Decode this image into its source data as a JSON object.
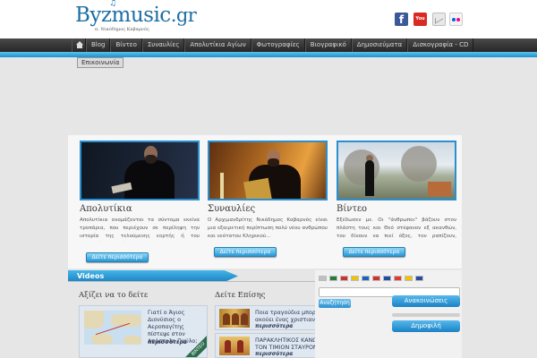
{
  "header": {
    "logo_text": "Byzmusic",
    "logo_tld": ".gr",
    "logo_note": "♫",
    "logo_subtitle": "π. Νικόδημος Καβαρνός",
    "social": [
      "facebook-icon",
      "youtube-icon",
      "mail-icon",
      "flickr-icon"
    ],
    "youtube_label": "You Tube",
    "facebook_label": "f"
  },
  "nav": {
    "items": [
      "Blog",
      "Βίντεο",
      "Συναυλίες",
      "Απολυτίκια Αγίων",
      "Φωτογραφίες",
      "Βιογραφικό",
      "Δημοσιεύματα",
      "Δισκογραφία - CD"
    ],
    "extra": "Επικοινωνία"
  },
  "features": [
    {
      "title": "Απολυτίκια",
      "text": "Απολυτίκια ονομάζονται τα σύντομα εκείνα τροπάρια, που περιέχουν σε περίληψη την ιστορία της τελούμενης εορτής ή του εορταζόμενου Αγίου.",
      "more": "Δείτε περισσότερα"
    },
    {
      "title": "Συναυλίες",
      "text": "Ο Αρχιμανδρίτης Νικόδημος Καβαρνός είναι μια εξαιρετική περίπτωση πολύ νέου ανθρώπου και νεότατου Κληρικού...",
      "more": "Δείτε περισσότερα"
    },
    {
      "title": "Βίντεο",
      "text": "Εξέδωσεν με. Οι \"άνθρωποι\" βάζουν στον πλάστη τους και Θεό στέφανον εξ ακανθών, του δίνουν να πιεί όξος, τον ραπίζουν, εμπτύουν...",
      "more": "Δείτε περισσότερα"
    }
  ],
  "videos": {
    "heading": "Videos",
    "left_title": "Αξίζει να το δείτε",
    "right_title": "Δείτε Επίσης",
    "featured": {
      "title": "Γιατί ο Άγιος Διονύσιος ο Αεροπαγίτης πίστεψε στον Απόστολο Παύλο;",
      "more": "περισσότερα",
      "ribbon": "ΒΙΝΤΕΟ"
    },
    "see_also": [
      {
        "title": "Ποια τραγούδια μπορεί να ακούει ένας χριστιανός;",
        "more": "περισσότερα"
      },
      {
        "title": "ΠΑΡΑΚΛΗΤΙΚΟΣ ΚΑΝΩΝ ΕΙΣ ΤΟΝ ΤΙΜΙΟΝ ΣΤΑΥΡΟΝ",
        "more": "περισσότερα"
      }
    ]
  },
  "sidebar": {
    "flags": [
      "#c0c0c0",
      "#2a7a3a",
      "#d32f2f",
      "#f2c200",
      "#1f5fbf",
      "#d32f2f",
      "#1e4fa3",
      "#e03b2e",
      "#f2c200",
      "#2a4a9f"
    ],
    "search_placeholder": "",
    "search_button": "Αναζήτηση",
    "buttons": [
      "Ανακοινώσεις",
      "Δημοφιλή"
    ]
  },
  "colors": {
    "accent": "#2a8fd0",
    "nav_dark": "#333333",
    "background": "#e6e6e6"
  }
}
